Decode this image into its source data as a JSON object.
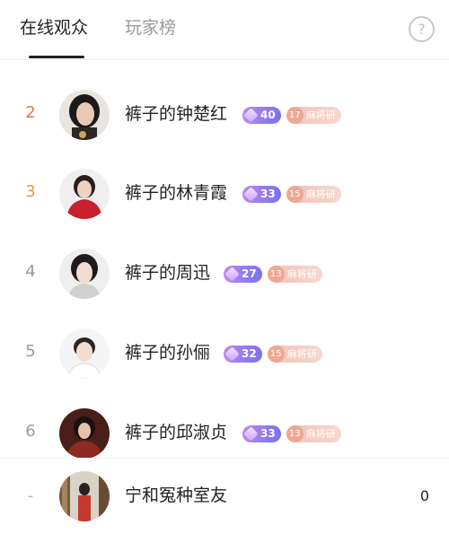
{
  "tabs": {
    "online": "在线观众",
    "ranking": "玩家榜",
    "help_symbol": "?"
  },
  "colors": {
    "rank_2": "#d97a4a",
    "rank_3": "#d7a23c",
    "rank_other": "#9a9a9a",
    "level_badge": "#8a77f0",
    "fan_badge": "#f2c0b2"
  },
  "rows": [
    {
      "rank": "2",
      "name": "裤子的钟楚红",
      "level": "40",
      "fan_level": "17",
      "fan_label": "麻将研"
    },
    {
      "rank": "3",
      "name": "裤子的林青霞",
      "level": "33",
      "fan_level": "15",
      "fan_label": "麻将研"
    },
    {
      "rank": "4",
      "name": "裤子的周迅",
      "level": "27",
      "fan_level": "13",
      "fan_label": "麻将研"
    },
    {
      "rank": "5",
      "name": "裤子的孙俪",
      "level": "32",
      "fan_level": "15",
      "fan_label": "麻将研"
    },
    {
      "rank": "6",
      "name": "裤子的邱淑贞",
      "level": "33",
      "fan_level": "13",
      "fan_label": "麻将研"
    }
  ],
  "me": {
    "rank": "-",
    "name": "宁和冤种室友",
    "score": "0"
  }
}
